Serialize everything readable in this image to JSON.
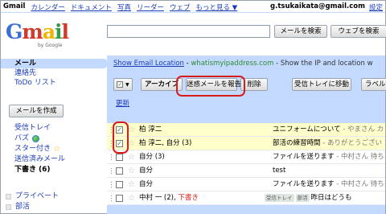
{
  "topbar": {
    "nav": [
      "Gmail",
      "カレンダー",
      "ドキュメント",
      "写真",
      "リーダー",
      "ウェブ",
      "もっと見る ▼"
    ],
    "email": "g.tsukaikata@gmail.com",
    "settings_link": "設定"
  },
  "header": {
    "logo_letters": [
      "G",
      "m",
      "a",
      "i",
      "l"
    ],
    "logo_sub": "by Google",
    "search_value": "",
    "search_mail_button": "メールを検索",
    "search_web_button": "ウェブを検索"
  },
  "sidebar": {
    "top_items": [
      {
        "label": "メール",
        "active": true
      },
      {
        "label": "連絡先",
        "active": false
      },
      {
        "label": "ToDo リスト",
        "active": false
      }
    ],
    "compose_button": "メールを作成",
    "folders": [
      {
        "label": "受信トレイ",
        "count": ""
      },
      {
        "label": "バズ",
        "count": ""
      },
      {
        "label": "スター付き",
        "count": ""
      },
      {
        "label": "送信済みメール",
        "count": ""
      },
      {
        "label": "下書き",
        "count": "(6)"
      }
    ],
    "labels": [
      "プライベート",
      "部活"
    ]
  },
  "main": {
    "web_clip": {
      "link": "Show Email Location",
      "site": "whatismyipaddress.com",
      "desc": " - Show the IP and location w"
    },
    "toolbar": {
      "select_check": "✓",
      "select_caret": "▼",
      "archive": "アーカイブ",
      "spam": "迷惑メールを報告",
      "delete": "削除",
      "move_to_inbox": "受信トレイに移動",
      "labels": "ラベル▼"
    },
    "refresh": "更新",
    "messages": [
      {
        "checked": true,
        "sender": "柏 淳二",
        "draft": "",
        "tags": [],
        "subject": "ユニフォームについて",
        "snippet": " - やまさん カ"
      },
      {
        "checked": true,
        "sender": "柏 淳二, 自分 (3)",
        "draft": "",
        "tags": [],
        "subject": "部活の練習時間",
        "snippet": " - ありがとうござい"
      },
      {
        "checked": false,
        "sender": "自分 (3)",
        "draft": "",
        "tags": [],
        "subject": "ファイルを送ります",
        "snippet": " - 中村さん 待ち"
      },
      {
        "checked": false,
        "sender": "自分",
        "draft": "",
        "tags": [],
        "subject": "test",
        "snippet": ""
      },
      {
        "checked": false,
        "sender": "自分",
        "draft": "",
        "tags": [],
        "subject": "ファイルを送ります",
        "snippet": " - 中村さん 待ち"
      },
      {
        "checked": false,
        "sender": "中村 一 (2), ",
        "draft": "下書き",
        "tags": [
          "受信トレイ",
          "部活"
        ],
        "subject": "昨日はどうも",
        "snippet": ""
      }
    ]
  }
}
